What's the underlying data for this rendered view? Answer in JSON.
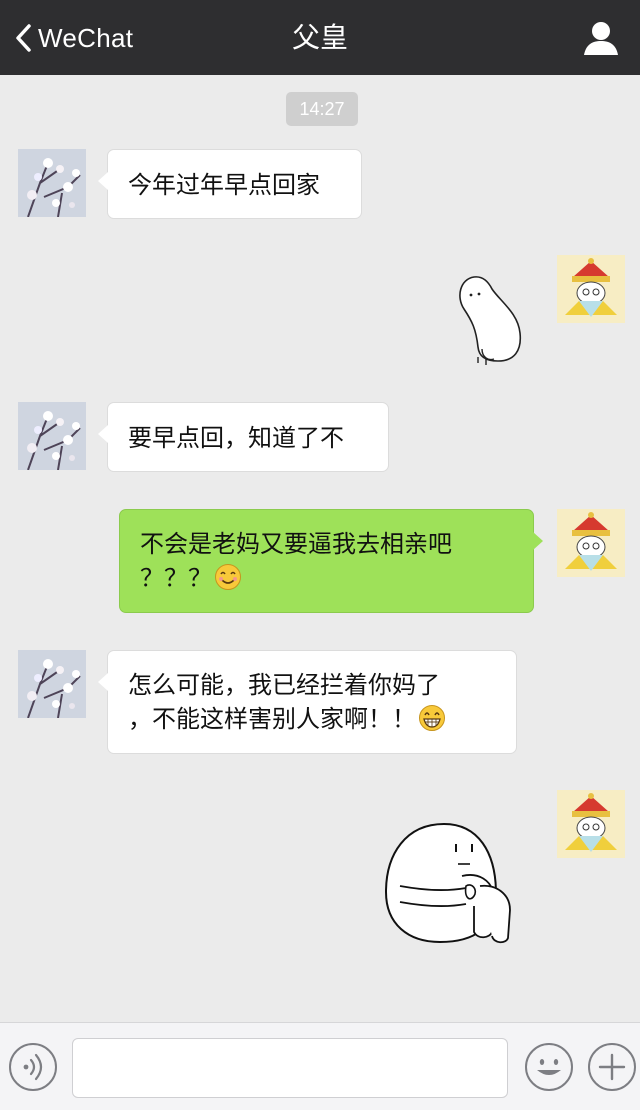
{
  "nav": {
    "back_label": "WeChat",
    "title": "父皇"
  },
  "chat": {
    "timestamp": "14:27",
    "messages": [
      {
        "sender": "father",
        "type": "text",
        "text": "今年过年早点回家"
      },
      {
        "sender": "me",
        "type": "sticker",
        "sticker": "white-blob-sitting-sticker"
      },
      {
        "sender": "father",
        "type": "text",
        "text": "要早点回，知道了不"
      },
      {
        "sender": "me",
        "type": "text",
        "line1": "不会是老妈又要逼我去相亲吧",
        "line2": "？？？",
        "emoji": "smile-emoji"
      },
      {
        "sender": "father",
        "type": "text",
        "line1": "怎么可能，我已经拦着你妈了",
        "line2": "，不能这样害别人家啊！！",
        "emoji": "grin-emoji"
      },
      {
        "sender": "me",
        "type": "sticker",
        "sticker": "white-blob-hugging-knees-sticker"
      }
    ]
  },
  "input_bar": {
    "voice_icon": "voice-icon",
    "emoji_icon": "emoji-icon",
    "plus_icon": "plus-icon"
  },
  "colors": {
    "navbar": "#2e2e30",
    "chat_background": "#ebebeb",
    "outgoing_bubble": "#9ee159",
    "incoming_bubble": "#ffffff"
  }
}
